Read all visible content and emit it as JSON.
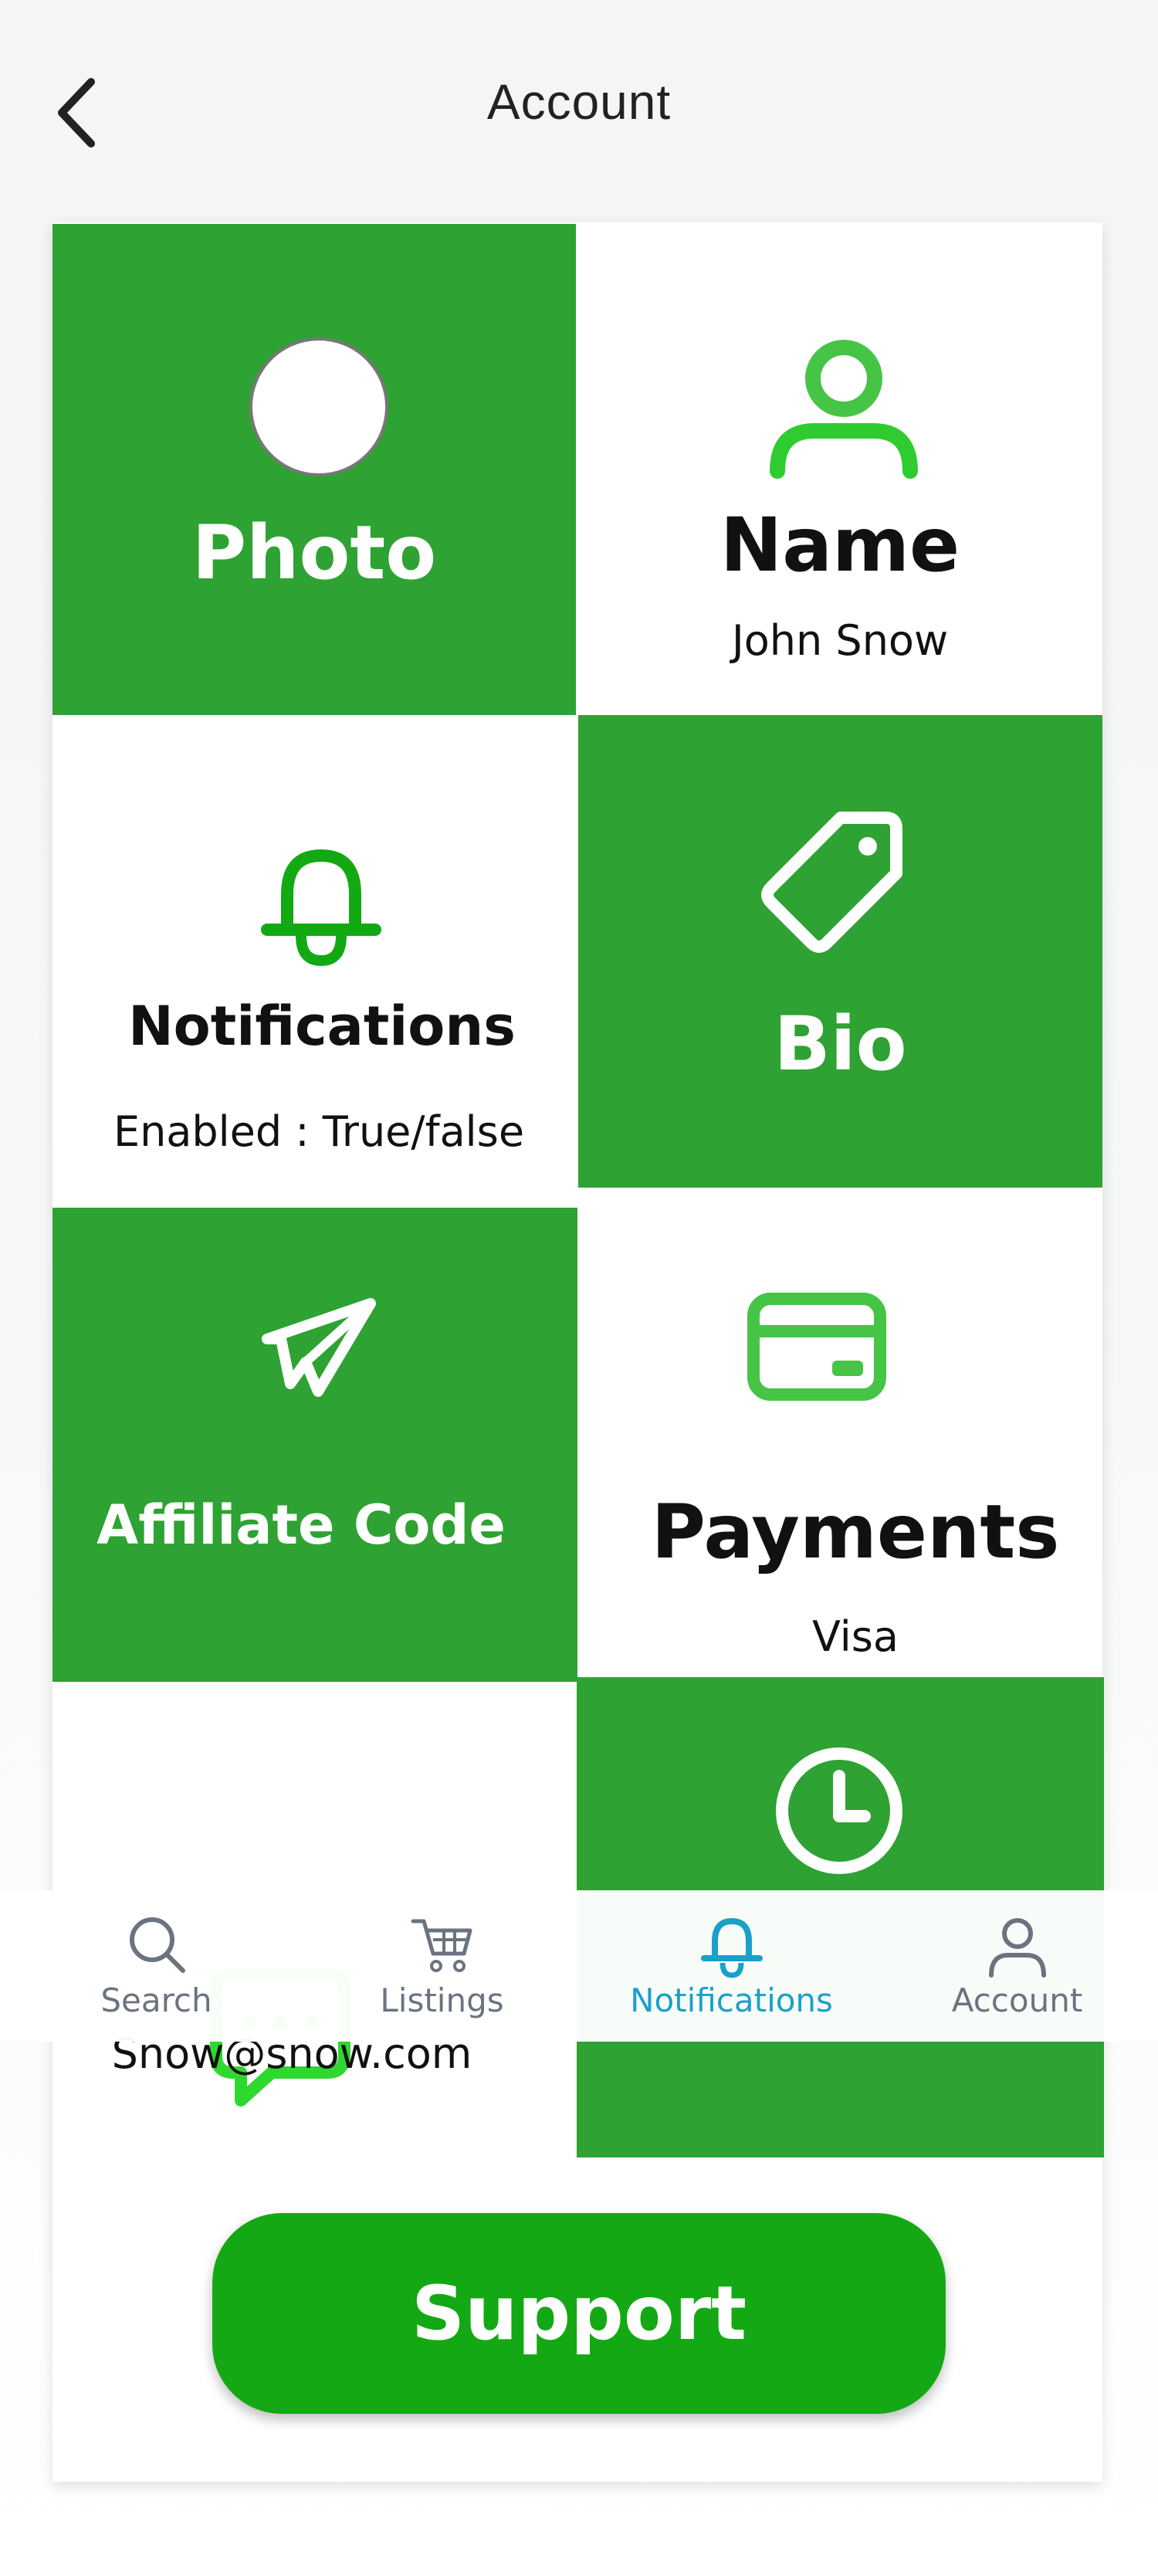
{
  "header": {
    "title": "Account"
  },
  "tiles": {
    "photo": {
      "label": "Photo"
    },
    "name": {
      "label": "Name",
      "value": "John Snow"
    },
    "notifications": {
      "label": "Notifications",
      "value": "Enabled : True/false"
    },
    "bio": {
      "label": "Bio"
    },
    "affiliate": {
      "label": "Affiliate Code"
    },
    "payments": {
      "label": "Payments",
      "value": "Visa"
    },
    "email": {
      "value": "Snow@snow.com"
    },
    "history": {}
  },
  "support": {
    "label": "Support"
  },
  "nav": {
    "items": [
      {
        "label": "Search",
        "icon": "search-icon"
      },
      {
        "label": "Listings",
        "icon": "cart-icon"
      },
      {
        "label": "Notifications",
        "icon": "bell-icon",
        "active": true
      },
      {
        "label": "Account",
        "icon": "user-icon"
      }
    ]
  },
  "colors": {
    "tile_green": "#2ea232",
    "icon_green": "#2fc52f",
    "support_green": "#14a914",
    "nav_active": "#1aa1c9",
    "nav_inactive": "#6b7380"
  }
}
